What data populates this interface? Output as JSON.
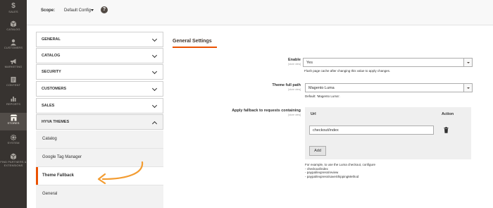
{
  "sidebar": {
    "items": [
      {
        "label": "Sales",
        "icon": "dollar-icon"
      },
      {
        "label": "Catalog",
        "icon": "catalog-cube-icon"
      },
      {
        "label": "Customers",
        "icon": "customers-icon"
      },
      {
        "label": "Marketing",
        "icon": "megaphone-icon"
      },
      {
        "label": "Content",
        "icon": "content-icon"
      },
      {
        "label": "Reports",
        "icon": "bar-chart-icon"
      },
      {
        "label": "Stores",
        "icon": "store-icon",
        "active": true
      },
      {
        "label": "System",
        "icon": "gear-icon"
      },
      {
        "label": "Find Partners & Extensions",
        "icon": "extensions-cube-icon"
      }
    ]
  },
  "header": {
    "scope_label": "Scope:",
    "scope_value": "Default Config",
    "help_icon_text": "?"
  },
  "tabs": [
    {
      "label": "GENERAL"
    },
    {
      "label": "CATALOG"
    },
    {
      "label": "SECURITY"
    },
    {
      "label": "CUSTOMERS"
    },
    {
      "label": "SALES"
    },
    {
      "label": "HYVA THEMES",
      "expanded": true
    }
  ],
  "subitems": [
    {
      "label": "Catalog"
    },
    {
      "label": "Google Tag Manager"
    },
    {
      "label": "Theme Fallback",
      "active": true
    },
    {
      "label": "General"
    }
  ],
  "section": {
    "title": "General Settings"
  },
  "fields": {
    "enable": {
      "label": "Enable",
      "scope": "[store view]",
      "value": "Yes",
      "note": "Flush page cache after changing this value to apply changes."
    },
    "theme_path": {
      "label": "Theme full path",
      "scope": "[store view]",
      "value": "Magento Luma",
      "note": "Default: 'Magento Luma'."
    },
    "fallback": {
      "label": "Apply fallback to requests containing",
      "scope": "[store view]",
      "col_url": "Url",
      "col_action": "Action",
      "row_value": "checkout/index",
      "add_label": "Add",
      "note_lines": [
        "For example, to use the Luma checkout, configure",
        "- checkout/index",
        "- paypal/express/review",
        "- paypal/express/saveShippingMethod"
      ]
    }
  },
  "colors": {
    "sidebar_bg": "#373330",
    "accent": "#eb5202",
    "arrow": "#f39c31"
  }
}
